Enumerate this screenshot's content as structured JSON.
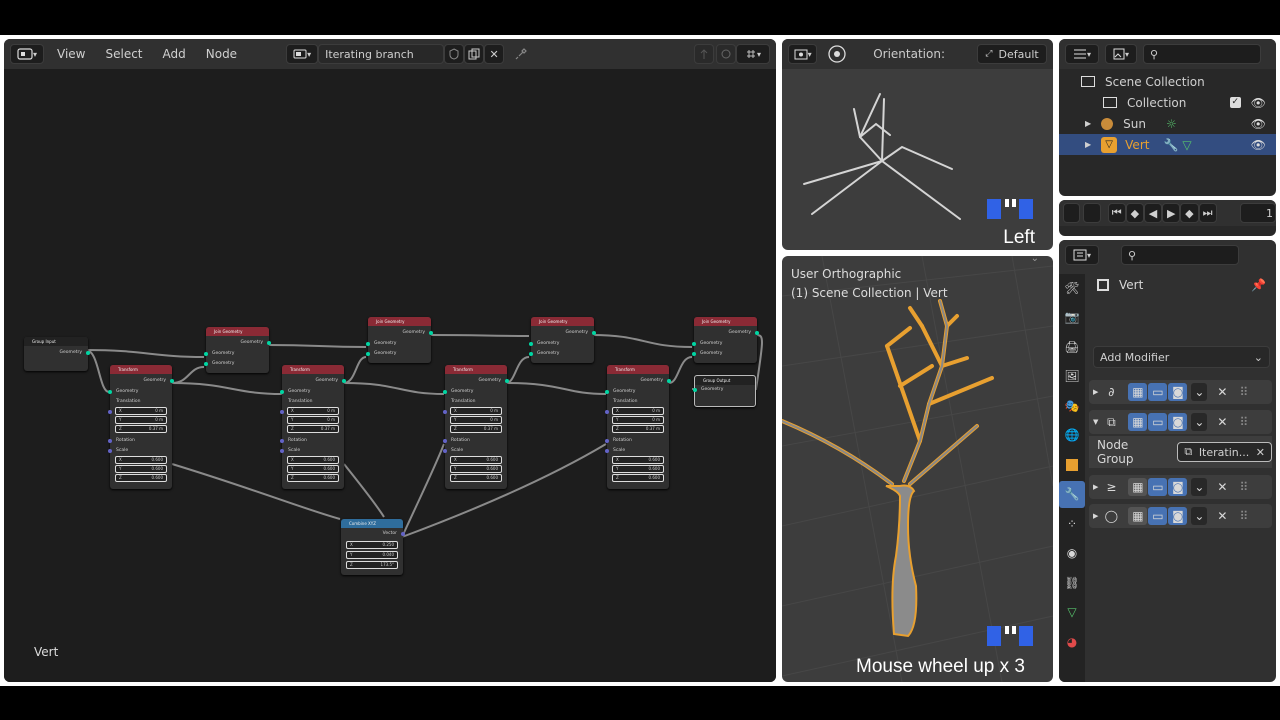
{
  "node_editor": {
    "menus": [
      "View",
      "Select",
      "Add",
      "Node"
    ],
    "tree_name": "Iterating branch",
    "object_label": "Vert",
    "nodes": {
      "group_input": {
        "title": "Group Input",
        "out": "Geometry"
      },
      "group_output": {
        "title": "Group Output",
        "in": "Geometry"
      },
      "join_title": "Join Geometry",
      "transform_title": "Transform",
      "combine_title": "Combine XYZ",
      "socket_geometry": "Geometry",
      "label_translation": "Translation",
      "label_rotation": "Rotation",
      "label_scale": "Scale",
      "label_vector": "Vector",
      "axis": [
        "X",
        "Y",
        "Z"
      ],
      "transforms": [
        {
          "t": [
            "0 m",
            "0 m",
            "0.37 m"
          ],
          "s": [
            "0.600",
            "0.600",
            "0.600"
          ]
        },
        {
          "t": [
            "0 m",
            "0 m",
            "0.37 m"
          ],
          "s": [
            "0.600",
            "0.600",
            "0.600"
          ]
        },
        {
          "t": [
            "0 m",
            "0 m",
            "0.37 m"
          ],
          "s": [
            "0.600",
            "0.600",
            "0.600"
          ]
        },
        {
          "t": [
            "0 m",
            "0 m",
            "0.37 m"
          ],
          "s": [
            "0.600",
            "0.600",
            "0.600"
          ]
        }
      ],
      "combine_values": [
        "0.250",
        "0.040",
        "173.5°"
      ]
    }
  },
  "viewport_top": {
    "orientation_label": "Orientation:",
    "orientation_value": "Default",
    "overlay_text": "Left"
  },
  "viewport_main": {
    "view_name": "User Orthographic",
    "collection_info": "(1) Scene Collection | Vert",
    "overlay_text": "Mouse wheel up x 3"
  },
  "outliner": {
    "rows": [
      "Scene Collection",
      "Collection",
      "Sun",
      "Vert"
    ]
  },
  "timeline": {
    "frame": "1"
  },
  "properties": {
    "object_name": "Vert",
    "add_modifier": "Add Modifier",
    "node_group_label": "Node Group",
    "node_group_value": "Iteratin...",
    "colors": {
      "accent": "#4772b3",
      "selected_object": "#e8a030",
      "node_header_red": "#8a2a35"
    }
  }
}
